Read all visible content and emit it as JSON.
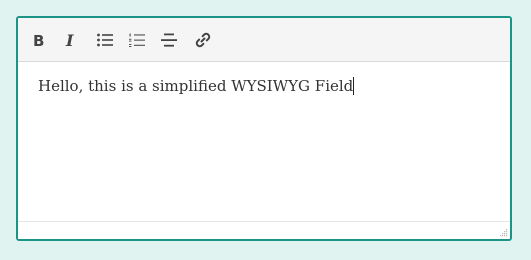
{
  "colors": {
    "page_background": "#e1f3f1",
    "editor_border": "#1a9486",
    "toolbar_background": "#f5f5f5",
    "icon_color": "#444444",
    "text_color": "#333333"
  },
  "toolbar": {
    "buttons": [
      {
        "icon": "bold-icon",
        "action": "bold"
      },
      {
        "icon": "italic-icon",
        "action": "italic"
      },
      {
        "icon": "bullet-list-icon",
        "action": "unordered list"
      },
      {
        "icon": "numbered-list-icon",
        "action": "ordered list"
      },
      {
        "icon": "strikethrough-icon",
        "action": "strikethrough"
      },
      {
        "icon": "link-icon",
        "action": "link"
      }
    ]
  },
  "editor": {
    "content": "Hello, this is a simplified WYSIWYG Field"
  }
}
